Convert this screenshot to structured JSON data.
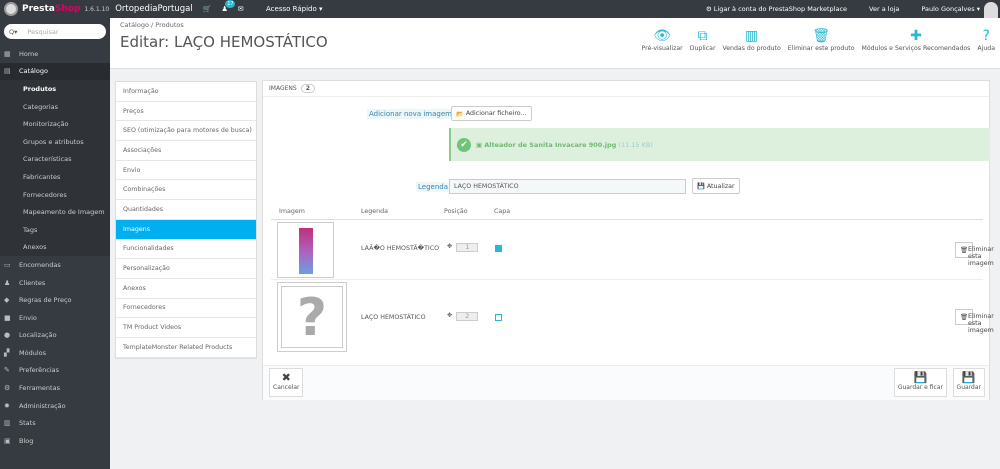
{
  "topbar": {
    "brand_a": "Presta",
    "brand_b": "Shop",
    "version": "1.6.1.10",
    "shop_name": "OrtopediaPortugal",
    "notifications_count": "17",
    "quick_access": "Acesso Rápido ▾",
    "marketplace": "Ligar à conta do PrestaShop Marketplace",
    "view_shop": "Ver a loja",
    "user": "Paulo  Gonçalves ▾"
  },
  "sidebar": {
    "search_placeholder": "Pesquisar",
    "search_icon": "Q▾",
    "items": [
      {
        "label": "Home",
        "icon": "▦"
      },
      {
        "label": "Catálogo",
        "icon": "▤",
        "active": true
      },
      {
        "label": "Produtos",
        "sub": true,
        "current": true
      },
      {
        "label": "Categorias",
        "sub": true
      },
      {
        "label": "Monitorização",
        "sub": true
      },
      {
        "label": "Grupos e atributos",
        "sub": true
      },
      {
        "label": "Características",
        "sub": true
      },
      {
        "label": "Fabricantes",
        "sub": true
      },
      {
        "label": "Fornecedores",
        "sub": true
      },
      {
        "label": "Mapeamento de Imagem",
        "sub": true
      },
      {
        "label": "Tags",
        "sub": true
      },
      {
        "label": "Anexos",
        "sub": true
      },
      {
        "label": "Encomendas",
        "icon": "▭"
      },
      {
        "label": "Clientes",
        "icon": "♟"
      },
      {
        "label": "Regras de Preço",
        "icon": "◆"
      },
      {
        "label": "Envio",
        "icon": "■"
      },
      {
        "label": "Localização",
        "icon": "●"
      },
      {
        "label": "Módulos",
        "icon": "▞"
      },
      {
        "label": "Preferências",
        "icon": "✎"
      },
      {
        "label": "Ferramentas",
        "icon": "⚙"
      },
      {
        "label": "Administração",
        "icon": "✹"
      },
      {
        "label": "Stats",
        "icon": "▥"
      },
      {
        "label": "Blog",
        "icon": "▣"
      }
    ]
  },
  "header": {
    "breadcrumb": "Catálogo  /  Produtos",
    "title": "Editar: LAÇO HEMOSTÁTICO",
    "tools": [
      {
        "label": "Pré-visualizar",
        "icon": "👁"
      },
      {
        "label": "Duplicar",
        "icon": "⧉"
      },
      {
        "label": "Vendas do produto",
        "icon": "▥"
      },
      {
        "label": "Eliminar este produto",
        "icon": "🗑"
      },
      {
        "label": "Módulos e Serviços Recomendados",
        "icon": "✚"
      },
      {
        "label": "Ajuda",
        "icon": "?"
      }
    ]
  },
  "tabs": [
    "Informação",
    "Preços",
    "SEO (otimização para motores de busca)",
    "Associações",
    "Envio",
    "Combinações",
    "Quantidades",
    "Imagens",
    "Funcionalidades",
    "Personalização",
    "Anexos",
    "Fornecedores",
    "TM Product Videos",
    "TemplateMonster Related Products"
  ],
  "selected_tab": "Imagens",
  "panel": {
    "heading": "IMAGENS",
    "count": "2",
    "add_label": "Adicionar nova imagem",
    "add_button": "Adicionar ficheiro...",
    "upload_file": "Alteador de Sanita Invacare 900.jpg",
    "upload_size": "(11.15 KB)",
    "caption_label": "Legenda",
    "caption_value": "LAÇO HEMOSTÁTICO",
    "update_button": "Atualizar",
    "columns": [
      "Imagem",
      "Legenda",
      "Posição",
      "Capa"
    ],
    "rows": [
      {
        "caption": "LAÃ�O HEMOSTÃ�TICO",
        "position": "1",
        "cover": true
      },
      {
        "caption": "LAÇO HEMOSTÁTICO",
        "position": "2",
        "cover": false
      }
    ],
    "delete_label": "Eliminar esta imagem",
    "cancel": "Cancelar",
    "save_stay": "Guardar e ficar",
    "save": "Guardar"
  }
}
